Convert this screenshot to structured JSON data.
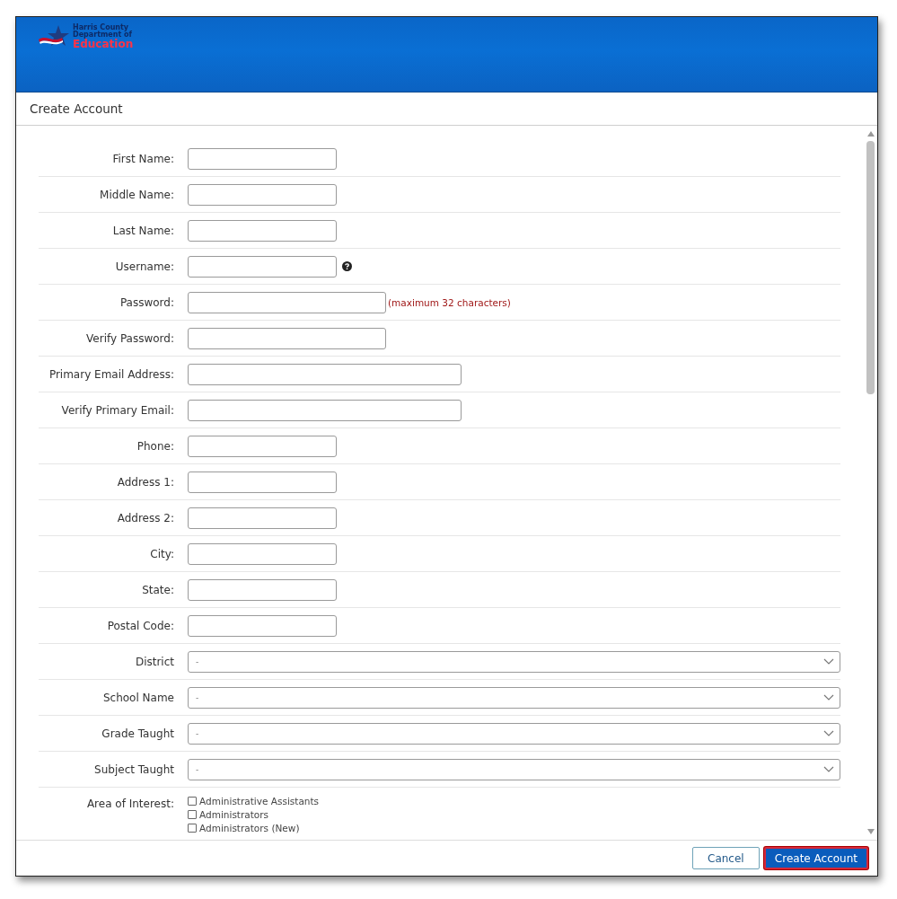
{
  "logo": {
    "lines": [
      "Harris County",
      "Department of",
      "Education"
    ]
  },
  "dialog": {
    "title": "Create Account"
  },
  "fields": [
    {
      "kind": "short",
      "label": "First Name:"
    },
    {
      "kind": "short",
      "label": "Middle Name:"
    },
    {
      "kind": "short",
      "label": "Last Name:"
    },
    {
      "kind": "short",
      "label": "Username:",
      "help": true
    },
    {
      "kind": "medium",
      "label": "Password:",
      "note": "(maximum 32 characters)"
    },
    {
      "kind": "medium",
      "label": "Verify Password:"
    },
    {
      "kind": "long",
      "label": "Primary Email Address:"
    },
    {
      "kind": "long",
      "label": "Verify Primary Email:"
    },
    {
      "kind": "short",
      "label": "Phone:"
    },
    {
      "kind": "short",
      "label": "Address 1:"
    },
    {
      "kind": "short",
      "label": "Address 2:"
    },
    {
      "kind": "short",
      "label": "City:"
    },
    {
      "kind": "short",
      "label": "State:"
    },
    {
      "kind": "short",
      "label": "Postal Code:"
    },
    {
      "kind": "select",
      "label": "District",
      "value": "-"
    },
    {
      "kind": "select",
      "label": "School Name",
      "value": "-"
    },
    {
      "kind": "select",
      "label": "Grade Taught",
      "value": "-"
    },
    {
      "kind": "select",
      "label": "Subject Taught",
      "value": "-"
    },
    {
      "kind": "checkboxes",
      "label": "Area of Interest:",
      "options": [
        {
          "label": "Administrative Assistants",
          "checked": false
        },
        {
          "label": "Administrators",
          "checked": false
        },
        {
          "label": "Administrators (New)",
          "checked": false
        }
      ]
    }
  ],
  "buttons": [
    {
      "label": "Cancel",
      "kind": "secondary"
    },
    {
      "label": "Create Account",
      "kind": "primary"
    }
  ]
}
